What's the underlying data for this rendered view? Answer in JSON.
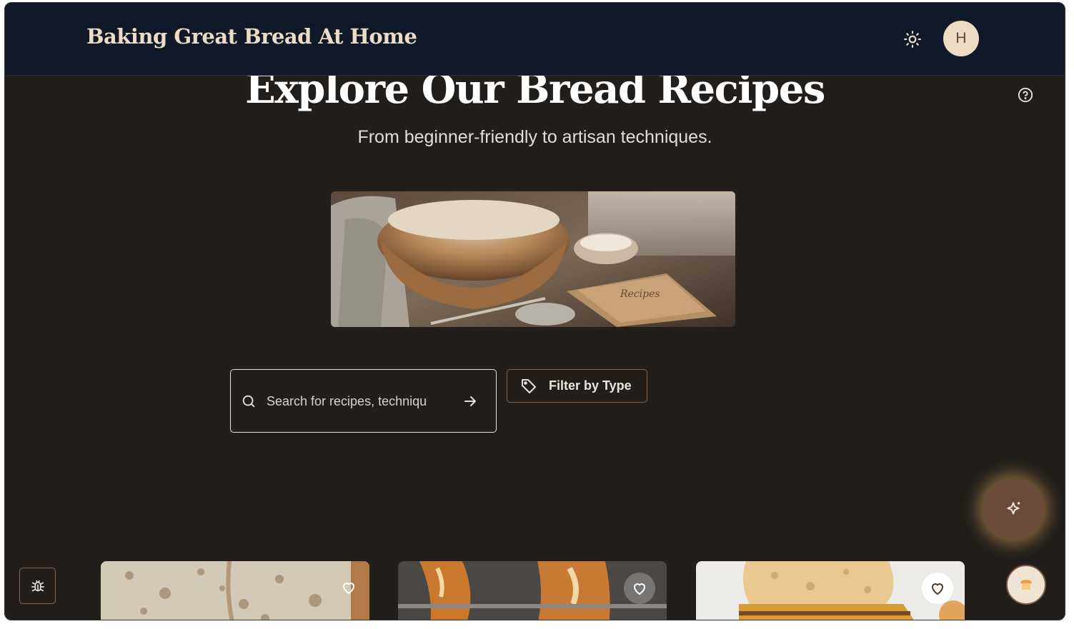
{
  "header": {
    "title": "Baking Great Bread At Home",
    "theme_toggle_icon": "sun-icon",
    "avatar_initial": "H"
  },
  "hero": {
    "title": "Explore Our Bread Recipes",
    "subtitle": "From beginner-friendly to artisan techniques.",
    "help_icon": "question-circle-icon",
    "image_alt_icon": "recipe-book-flour-bowl-image"
  },
  "search": {
    "placeholder": "Search for recipes, techniques...",
    "value": "",
    "submit_icon": "arrow-right-icon"
  },
  "filter": {
    "label": "Filter by Type",
    "icon": "tag-icon"
  },
  "floating": {
    "ai_icon": "sparkles-icon",
    "bread_icon": "bread-icon",
    "bug_icon": "bug-icon"
  },
  "cards": [
    {
      "image": "sourdough-crumb-image",
      "favorite_icon": "heart-icon"
    },
    {
      "image": "baguettes-image",
      "favorite_icon": "heart-icon"
    },
    {
      "image": "focaccia-image",
      "favorite_icon": "heart-icon"
    }
  ],
  "colors": {
    "background": "#211e1b",
    "header": "#111827",
    "accent_brown": "#8a6347",
    "avatar_bg": "#ecdcc4",
    "glow": "#d6a054"
  }
}
